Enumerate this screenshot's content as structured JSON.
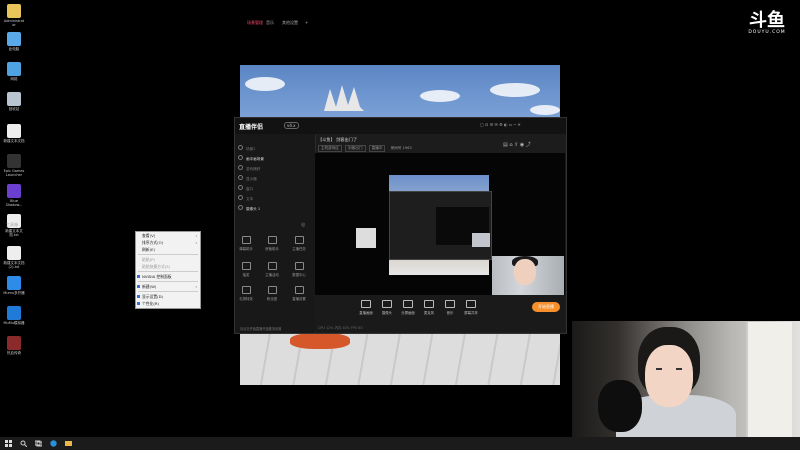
{
  "desktop": {
    "icons": [
      {
        "label": "Administrat or",
        "icon": "folder-user-icon",
        "color": "#e8c45a"
      },
      {
        "label": "此电脑",
        "icon": "computer-icon",
        "color": "#5aa9e8"
      },
      {
        "label": "网络",
        "icon": "network-icon",
        "color": "#4fa3e0"
      },
      {
        "label": "回收站",
        "icon": "recycle-bin-icon",
        "color": "#b8c4cf"
      },
      {
        "label": "新建文本文档",
        "icon": "text-file-icon",
        "color": "#eeeeee"
      },
      {
        "label": "Epic Games Launcher",
        "icon": "epic-games-icon",
        "color": "#333333"
      },
      {
        "label": "Blue Shadow...",
        "icon": "app-icon",
        "color": "#6b3fcf"
      },
      {
        "label": "新建文本文档.txt",
        "icon": "text-file-icon",
        "color": "#eeeeee"
      },
      {
        "label": "新建文本文档 (2).txt",
        "icon": "text-file-icon",
        "color": "#eeeeee"
      },
      {
        "label": "Mumu多开器",
        "icon": "mumu-icon",
        "color": "#2d8ce8"
      },
      {
        "label": "MuMu模拟器",
        "icon": "mumu-icon",
        "color": "#1f7ad8"
      },
      {
        "label": "热血传奇",
        "icon": "game-icon",
        "color": "#8a2a2a"
      }
    ]
  },
  "context_menu": {
    "items": [
      {
        "label": "查看(V)",
        "arrow": "›",
        "dim": false
      },
      {
        "label": "排序方式(O)",
        "arrow": "›",
        "dim": false
      },
      {
        "label": "刷新(E)",
        "arrow": "",
        "dim": false
      },
      {
        "label": "粘贴(P)",
        "arrow": "",
        "dim": true
      },
      {
        "label": "粘贴快捷方式(S)",
        "arrow": "",
        "dim": true
      },
      {
        "label": "NVIDIA 控制面板",
        "arrow": "",
        "dim": false
      },
      {
        "label": "新建(W)",
        "arrow": "›",
        "dim": false
      },
      {
        "label": "显示设置(D)",
        "arrow": "",
        "dim": false
      },
      {
        "label": "个性化(R)",
        "arrow": "",
        "dim": false
      }
    ]
  },
  "obs": {
    "app_name": "直播伴侣",
    "version_badge": "v4.x",
    "tabs": [
      "场景管理",
      "音乐",
      "其他设置"
    ],
    "scenes": [
      "场景1",
      "画中画场景",
      "游戏捕获",
      "显示器",
      "窗口",
      "文本",
      "摄像头 1"
    ],
    "tools_title": "工具箱",
    "tools": [
      "弹幕助手",
      "房管助手",
      "主播任务",
      "抽奖",
      "主播活动",
      "数据中心",
      "礼物特效",
      "粉丝团",
      "直播设置"
    ],
    "room_title": "【斗鱼】 剑客出门了",
    "room_tags": [
      "主机游戏区",
      "剑客出门",
      "直播中"
    ],
    "room_meta": "房间号 1963",
    "bottom_items": [
      "直播画面",
      "摄像头",
      "分屏画面",
      "麦克风",
      "音乐",
      "屏幕共享"
    ],
    "start_button": "开始直播",
    "status_line": "CPU 12% 内存 40% FPS 60",
    "footer": "请点击开始直播开始推流设置"
  },
  "watermark": {
    "logo_text": "斗鱼",
    "site": "DOUYU.COM"
  },
  "colors": {
    "accent": "#f7902b",
    "obs_bg": "#1c1c1c",
    "tab_active": "#ff4466"
  }
}
